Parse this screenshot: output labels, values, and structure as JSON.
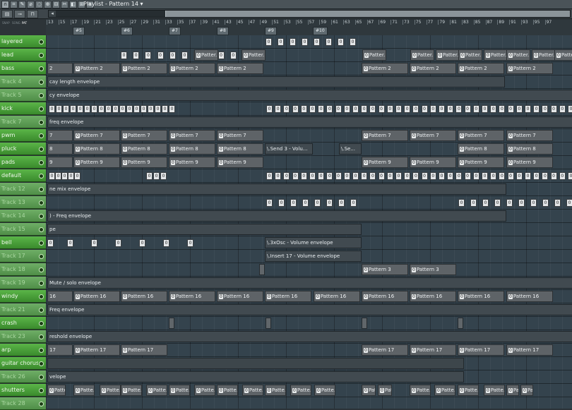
{
  "window": {
    "title": "Playlist - Pattern 14 ▾"
  },
  "toolbar": {
    "tools": [
      "∩",
      "⌗",
      "✎",
      "⌀",
      "◌",
      "⊕",
      "⊟",
      "✂",
      "◧",
      "⊞",
      "»"
    ],
    "snap_label": "SNAP",
    "song_label": "SONG",
    "pat_label": "PAT"
  },
  "ruler": {
    "ticks": [
      "13",
      "15",
      "17",
      "19",
      "21",
      "23",
      "25",
      "27",
      "29",
      "31",
      "33",
      "35",
      "37",
      "39",
      "41",
      "43",
      "45",
      "47",
      "49",
      "51",
      "53",
      "55",
      "57",
      "59",
      "61",
      "63",
      "65",
      "67",
      "69",
      "71",
      "73",
      "75",
      "77",
      "79",
      "81",
      "83",
      "85",
      "87",
      "89",
      "91",
      "93",
      "95",
      "97"
    ],
    "markers": [
      "#5",
      "#6",
      "#7",
      "#8",
      "#9",
      "#10"
    ]
  },
  "tracks": [
    {
      "name": "layered",
      "empty": false
    },
    {
      "name": "lead",
      "empty": false
    },
    {
      "name": "bass",
      "empty": false
    },
    {
      "name": "Track 4",
      "empty": true
    },
    {
      "name": "Track 5",
      "empty": true
    },
    {
      "name": "kick",
      "empty": false
    },
    {
      "name": "Track 7",
      "empty": true
    },
    {
      "name": "pwm",
      "empty": false
    },
    {
      "name": "pluck",
      "empty": false
    },
    {
      "name": "pads",
      "empty": false
    },
    {
      "name": "default",
      "empty": false
    },
    {
      "name": "Track 12",
      "empty": true
    },
    {
      "name": "Track 13",
      "empty": true
    },
    {
      "name": "Track 14",
      "empty": true
    },
    {
      "name": "Track 15",
      "empty": true
    },
    {
      "name": "bell",
      "empty": false
    },
    {
      "name": "Track 17",
      "empty": true
    },
    {
      "name": "Track 18",
      "empty": true
    },
    {
      "name": "Track 19",
      "empty": true
    },
    {
      "name": "windy",
      "empty": false
    },
    {
      "name": "Track 21",
      "empty": true
    },
    {
      "name": "crash",
      "empty": false
    },
    {
      "name": "Track 23",
      "empty": true
    },
    {
      "name": "arp",
      "empty": false
    },
    {
      "name": "guitar chorus",
      "empty": false
    },
    {
      "name": "Track 26",
      "empty": true
    },
    {
      "name": "shutters",
      "empty": false
    },
    {
      "name": "Track 28",
      "empty": true
    }
  ],
  "clips": {
    "lead": "Patter...",
    "bass_first": "2",
    "bass": "Pattern 2",
    "t4": "cay length envelope",
    "t5": "cy envelope",
    "t7": "freq envelope",
    "pwm_first": "7",
    "pwm": "Pattern 7",
    "pluck_first": "8",
    "pluck": "Pattern 8",
    "pluck_send": "\\.Send 3 - Volu...",
    "pluck_se": "\\.Se...",
    "pads_first": "9",
    "pads": "Pattern 9",
    "t12": "ne mix envelope",
    "t14": ") - Freq envelope",
    "t15": "pe",
    "bell_osc": "\\.3xOsc - Volume envelope",
    "t17": "\\.Insert 17 - Volume envelope",
    "t18": "Pattern 3",
    "t19": "Mute / solo envelope",
    "windy_first": "16",
    "windy": "Pattern 16",
    "t21": "Freq envelope",
    "t23": "reshold envelope",
    "arp_first": "17",
    "arp": "Pattern 17",
    "t26": "velope",
    "shutters": "Patte..."
  },
  "colors": {
    "track_green": "#4fa33e",
    "playlist_bg": "#34434d",
    "clip_gray": "#5e6367"
  }
}
